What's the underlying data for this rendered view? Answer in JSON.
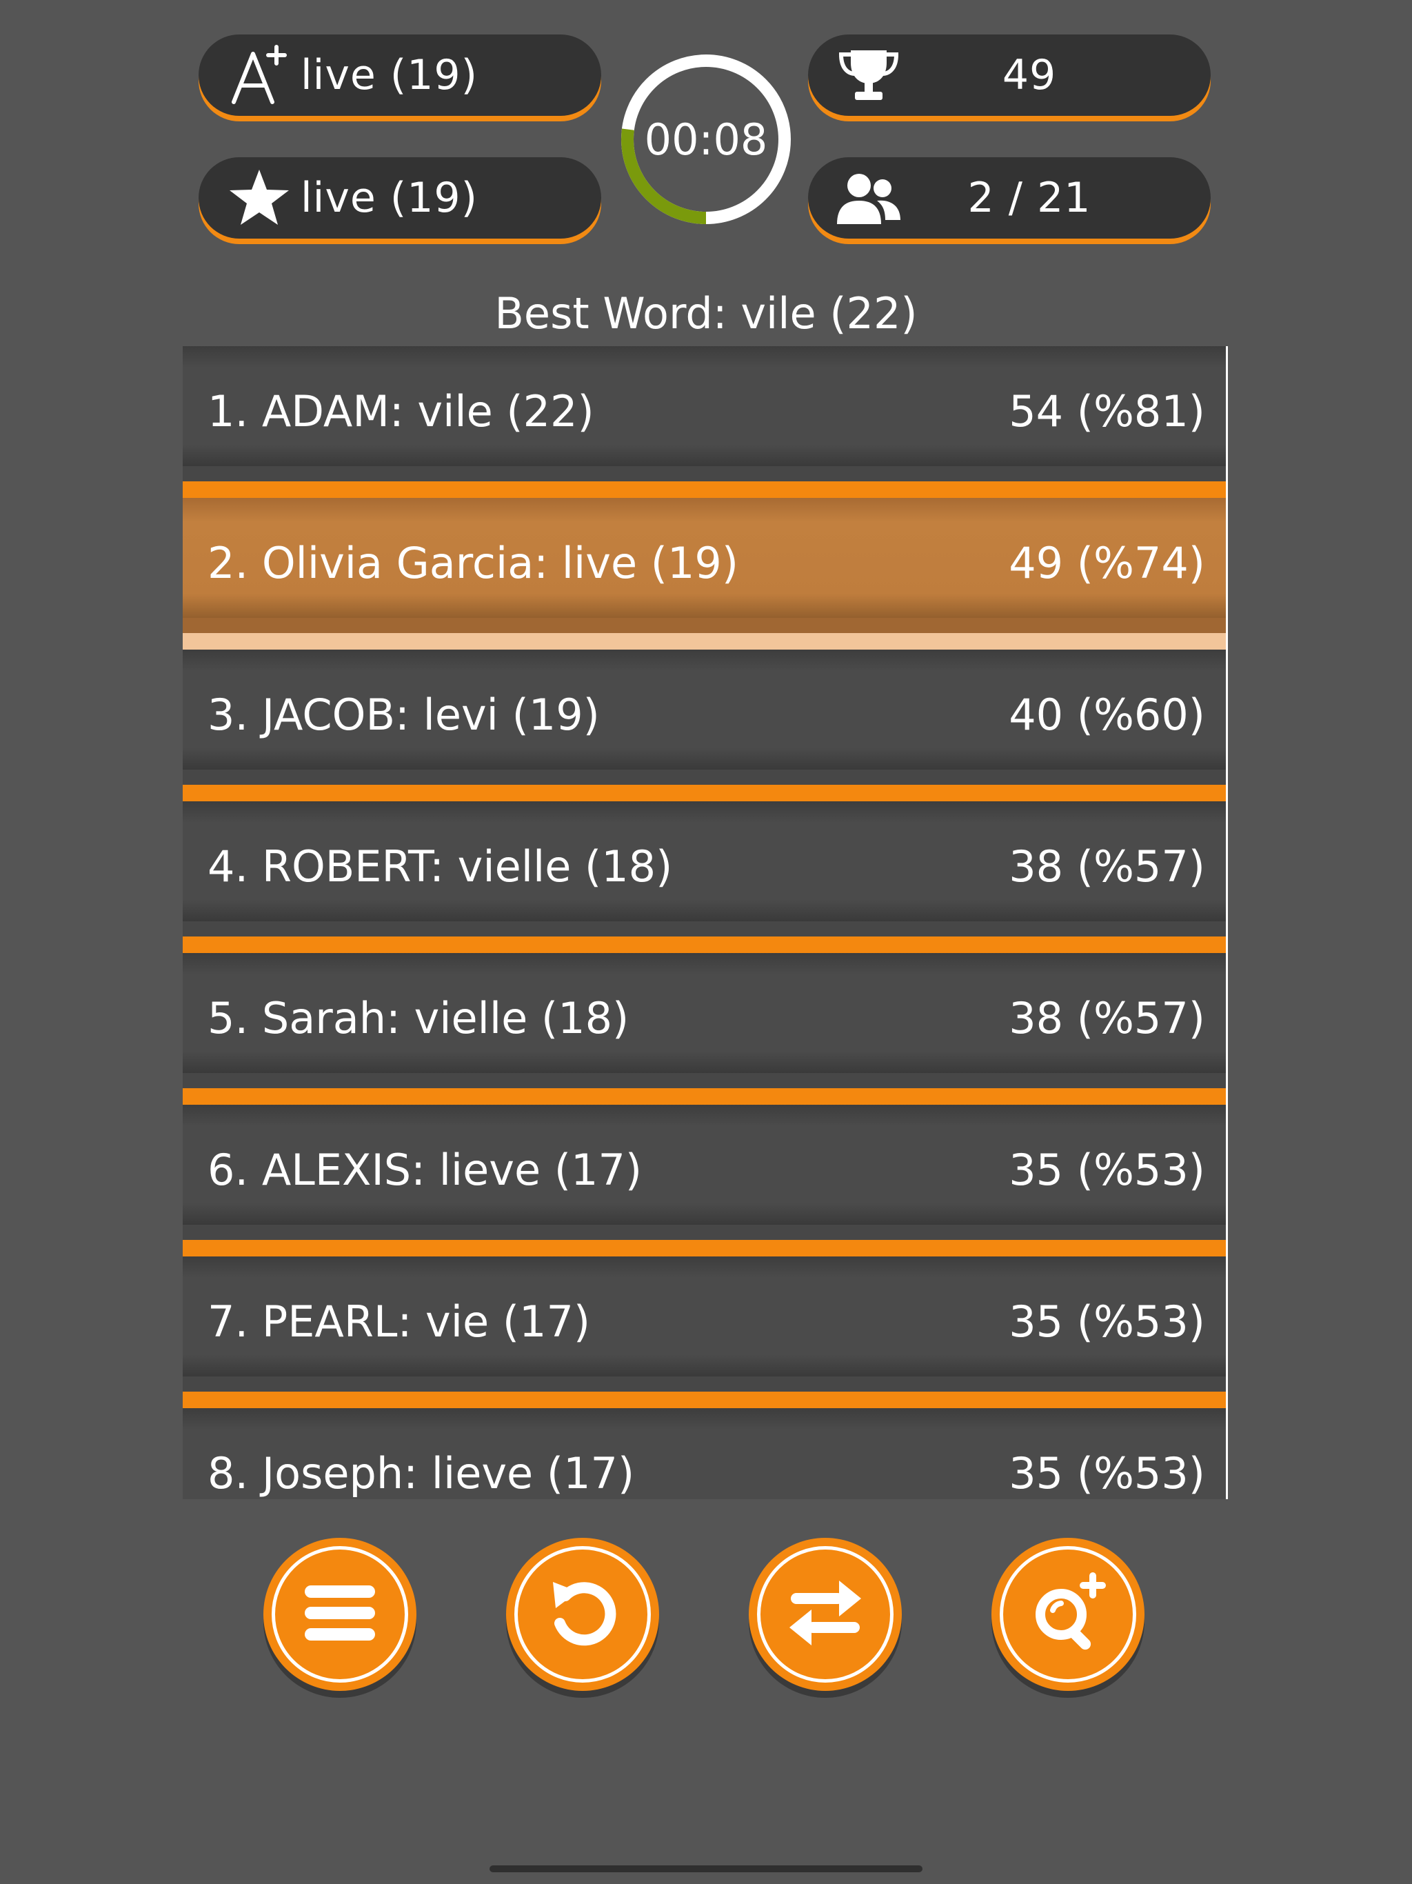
{
  "header": {
    "best_word_pill": {
      "icon": "a-plus-icon",
      "text": "live (19)"
    },
    "score_word_pill": {
      "icon": "star-icon",
      "text": "live (19)"
    },
    "trophy_pill": {
      "icon": "trophy-icon",
      "text": "49"
    },
    "players_pill": {
      "icon": "users-icon",
      "text": "2 / 21"
    },
    "timer": {
      "text": "00:08",
      "progress_fraction": 0.27
    }
  },
  "best_word": "Best Word: vile (22)",
  "leaderboard": [
    {
      "name": "1. ADAM: vile (22)",
      "score": "54 (%81)",
      "highlight": false
    },
    {
      "name": "2. Olivia Garcia: live (19)",
      "score": "49 (%74)",
      "highlight": true
    },
    {
      "name": "3. JACOB: levi (19)",
      "score": "40 (%60)",
      "highlight": false
    },
    {
      "name": "4. ROBERT: vielle (18)",
      "score": "38 (%57)",
      "highlight": false
    },
    {
      "name": "5. Sarah: vielle (18)",
      "score": "38 (%57)",
      "highlight": false
    },
    {
      "name": "6. ALEXIS: lieve (17)",
      "score": "35 (%53)",
      "highlight": false
    },
    {
      "name": "7. PEARL: vie (17)",
      "score": "35 (%53)",
      "highlight": false
    },
    {
      "name": "8. Joseph: lieve (17)",
      "score": "35 (%53)",
      "highlight": false
    }
  ],
  "buttons": [
    {
      "name": "menu-button",
      "icon": "menu-icon"
    },
    {
      "name": "retry-button",
      "icon": "retry-icon"
    },
    {
      "name": "swap-button",
      "icon": "swap-icon"
    },
    {
      "name": "zoom-button",
      "icon": "zoom-plus-icon"
    }
  ],
  "colors": {
    "background": "#555555",
    "accent": "#f4880f",
    "highlight_row": "#c2803f",
    "timer_elapsed": "#7a9a0c",
    "timer_remaining": "#ffffff"
  }
}
